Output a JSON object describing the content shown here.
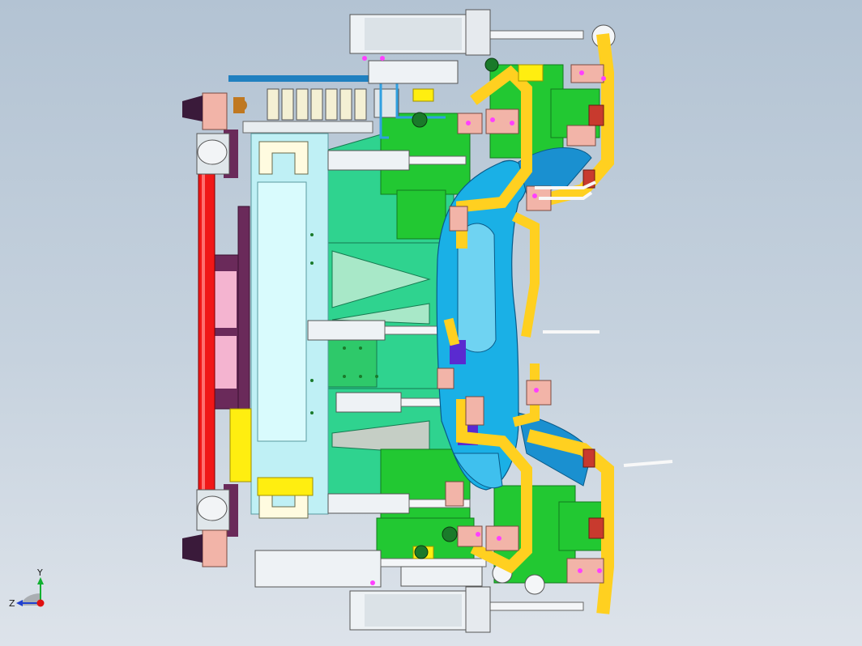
{
  "viewport": {
    "background_top": "#b3c3d3",
    "background_bottom": "#dde3ea"
  },
  "model": {
    "name": "",
    "colors": {
      "fixture_green": "#22c832",
      "sea_green": "#2fd38f",
      "part_blue": "#1ab0e6",
      "clamp_yellow": "#ffd020",
      "cylinder_white": "#eef2f5",
      "pad_pink": "#f2b4a8",
      "rail_red": "#f01818",
      "plate_purple": "#6a2a5a",
      "frame_cyan": "#bff0f5"
    }
  },
  "triad": {
    "y_label": "Y",
    "z_label": "Z",
    "x_axis_color": "#e01010",
    "y_axis_color": "#10b030",
    "z_axis_color": "#2040d0"
  }
}
